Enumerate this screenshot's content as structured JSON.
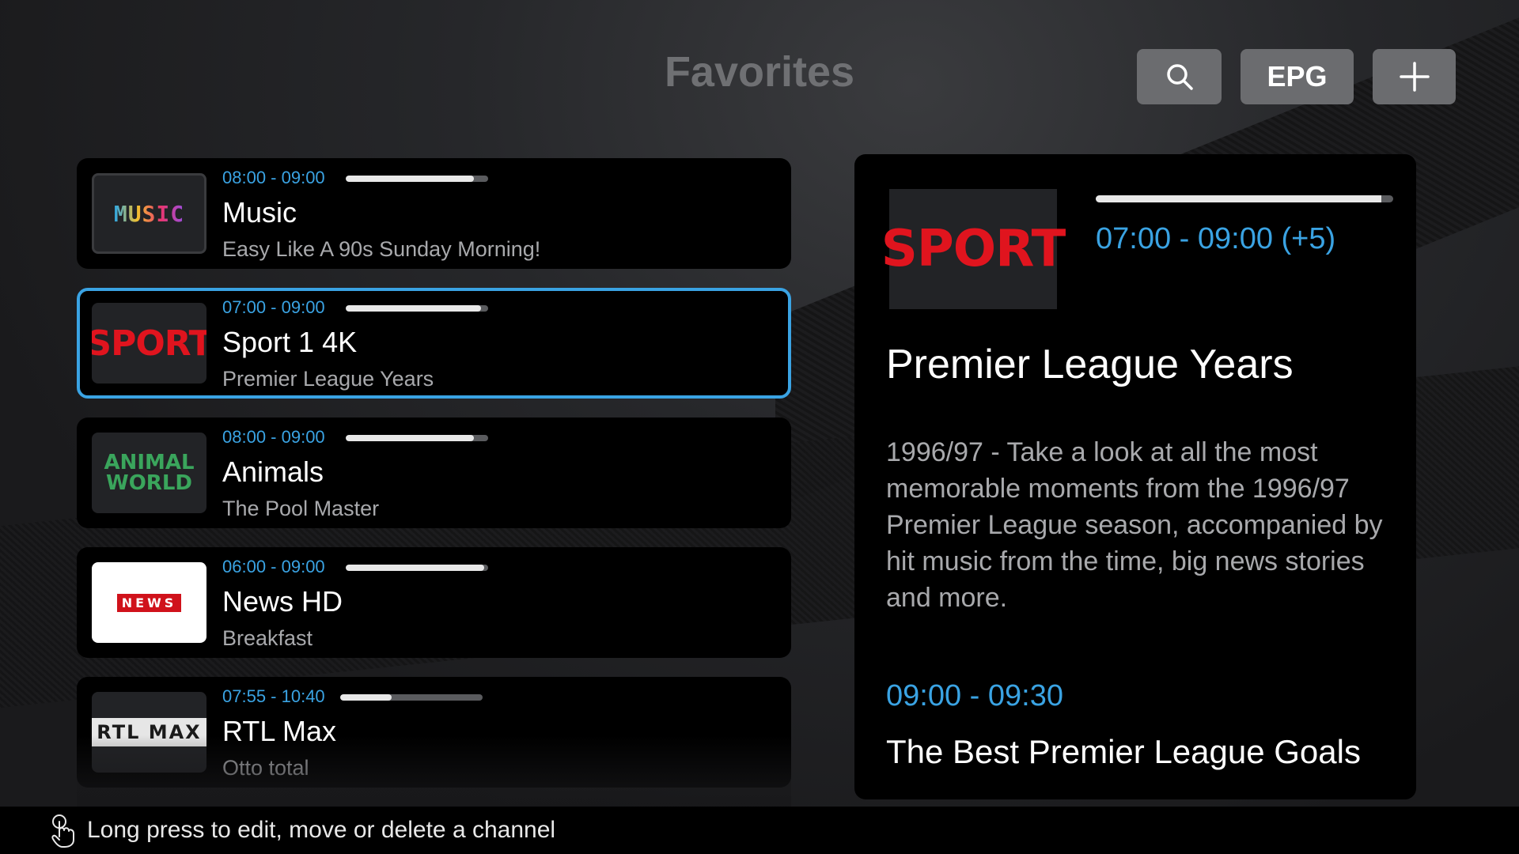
{
  "header": {
    "title": "Favorites",
    "epg_label": "EPG"
  },
  "channels": [
    {
      "logo": "MUSIC",
      "time": "08:00 - 09:00",
      "progress": 0.9,
      "name": "Music",
      "program": "Easy Like A 90s Sunday Morning!"
    },
    {
      "logo": "SPORT",
      "time": "07:00 - 09:00",
      "progress": 0.95,
      "name": "Sport 1 4K",
      "program": "Premier League Years"
    },
    {
      "logo": "ANIMAL WORLD",
      "time": "08:00 - 09:00",
      "progress": 0.9,
      "name": "Animals",
      "program": "The Pool Master"
    },
    {
      "logo": "NEWS",
      "time": "06:00 - 09:00",
      "progress": 0.97,
      "name": "News HD",
      "program": "Breakfast"
    },
    {
      "logo": "RTL MAX",
      "time": "07:55 - 10:40",
      "progress": 0.36,
      "name": "RTL Max",
      "program": "Otto total"
    }
  ],
  "detail": {
    "logo": "SPORT",
    "progress": 0.96,
    "time": "07:00 - 09:00 (+5)",
    "title": "Premier League Years",
    "description": "1996/97 - Take a look at all the most memorable moments from the 1996/97 Premier League season, accompanied by hit music from the time, big news stories and more.",
    "next_time": "09:00 - 09:30",
    "next_title": "The Best Premier League Goals"
  },
  "footer": {
    "hint": "Long press to edit, move or delete a channel"
  },
  "colors": {
    "accent": "#3aa3e3",
    "sport_red": "#e0141e"
  },
  "icons": [
    "search-icon",
    "plus-icon",
    "touch-icon"
  ]
}
